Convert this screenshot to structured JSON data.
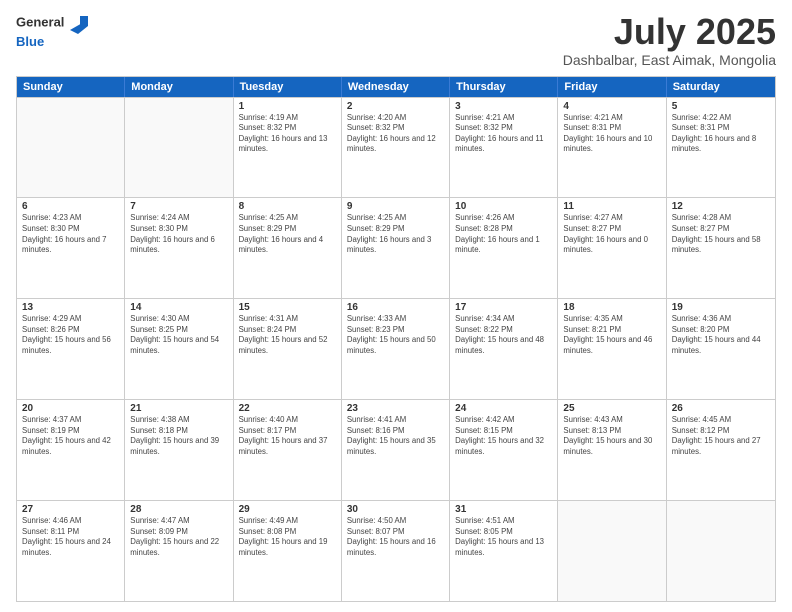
{
  "header": {
    "logo_line1": "General",
    "logo_line2": "Blue",
    "month_title": "July 2025",
    "subtitle": "Dashbalbar, East Aimak, Mongolia"
  },
  "weekdays": [
    "Sunday",
    "Monday",
    "Tuesday",
    "Wednesday",
    "Thursday",
    "Friday",
    "Saturday"
  ],
  "weeks": [
    [
      {
        "day": "",
        "info": ""
      },
      {
        "day": "",
        "info": ""
      },
      {
        "day": "1",
        "info": "Sunrise: 4:19 AM\nSunset: 8:32 PM\nDaylight: 16 hours and 13 minutes."
      },
      {
        "day": "2",
        "info": "Sunrise: 4:20 AM\nSunset: 8:32 PM\nDaylight: 16 hours and 12 minutes."
      },
      {
        "day": "3",
        "info": "Sunrise: 4:21 AM\nSunset: 8:32 PM\nDaylight: 16 hours and 11 minutes."
      },
      {
        "day": "4",
        "info": "Sunrise: 4:21 AM\nSunset: 8:31 PM\nDaylight: 16 hours and 10 minutes."
      },
      {
        "day": "5",
        "info": "Sunrise: 4:22 AM\nSunset: 8:31 PM\nDaylight: 16 hours and 8 minutes."
      }
    ],
    [
      {
        "day": "6",
        "info": "Sunrise: 4:23 AM\nSunset: 8:30 PM\nDaylight: 16 hours and 7 minutes."
      },
      {
        "day": "7",
        "info": "Sunrise: 4:24 AM\nSunset: 8:30 PM\nDaylight: 16 hours and 6 minutes."
      },
      {
        "day": "8",
        "info": "Sunrise: 4:25 AM\nSunset: 8:29 PM\nDaylight: 16 hours and 4 minutes."
      },
      {
        "day": "9",
        "info": "Sunrise: 4:25 AM\nSunset: 8:29 PM\nDaylight: 16 hours and 3 minutes."
      },
      {
        "day": "10",
        "info": "Sunrise: 4:26 AM\nSunset: 8:28 PM\nDaylight: 16 hours and 1 minute."
      },
      {
        "day": "11",
        "info": "Sunrise: 4:27 AM\nSunset: 8:27 PM\nDaylight: 16 hours and 0 minutes."
      },
      {
        "day": "12",
        "info": "Sunrise: 4:28 AM\nSunset: 8:27 PM\nDaylight: 15 hours and 58 minutes."
      }
    ],
    [
      {
        "day": "13",
        "info": "Sunrise: 4:29 AM\nSunset: 8:26 PM\nDaylight: 15 hours and 56 minutes."
      },
      {
        "day": "14",
        "info": "Sunrise: 4:30 AM\nSunset: 8:25 PM\nDaylight: 15 hours and 54 minutes."
      },
      {
        "day": "15",
        "info": "Sunrise: 4:31 AM\nSunset: 8:24 PM\nDaylight: 15 hours and 52 minutes."
      },
      {
        "day": "16",
        "info": "Sunrise: 4:33 AM\nSunset: 8:23 PM\nDaylight: 15 hours and 50 minutes."
      },
      {
        "day": "17",
        "info": "Sunrise: 4:34 AM\nSunset: 8:22 PM\nDaylight: 15 hours and 48 minutes."
      },
      {
        "day": "18",
        "info": "Sunrise: 4:35 AM\nSunset: 8:21 PM\nDaylight: 15 hours and 46 minutes."
      },
      {
        "day": "19",
        "info": "Sunrise: 4:36 AM\nSunset: 8:20 PM\nDaylight: 15 hours and 44 minutes."
      }
    ],
    [
      {
        "day": "20",
        "info": "Sunrise: 4:37 AM\nSunset: 8:19 PM\nDaylight: 15 hours and 42 minutes."
      },
      {
        "day": "21",
        "info": "Sunrise: 4:38 AM\nSunset: 8:18 PM\nDaylight: 15 hours and 39 minutes."
      },
      {
        "day": "22",
        "info": "Sunrise: 4:40 AM\nSunset: 8:17 PM\nDaylight: 15 hours and 37 minutes."
      },
      {
        "day": "23",
        "info": "Sunrise: 4:41 AM\nSunset: 8:16 PM\nDaylight: 15 hours and 35 minutes."
      },
      {
        "day": "24",
        "info": "Sunrise: 4:42 AM\nSunset: 8:15 PM\nDaylight: 15 hours and 32 minutes."
      },
      {
        "day": "25",
        "info": "Sunrise: 4:43 AM\nSunset: 8:13 PM\nDaylight: 15 hours and 30 minutes."
      },
      {
        "day": "26",
        "info": "Sunrise: 4:45 AM\nSunset: 8:12 PM\nDaylight: 15 hours and 27 minutes."
      }
    ],
    [
      {
        "day": "27",
        "info": "Sunrise: 4:46 AM\nSunset: 8:11 PM\nDaylight: 15 hours and 24 minutes."
      },
      {
        "day": "28",
        "info": "Sunrise: 4:47 AM\nSunset: 8:09 PM\nDaylight: 15 hours and 22 minutes."
      },
      {
        "day": "29",
        "info": "Sunrise: 4:49 AM\nSunset: 8:08 PM\nDaylight: 15 hours and 19 minutes."
      },
      {
        "day": "30",
        "info": "Sunrise: 4:50 AM\nSunset: 8:07 PM\nDaylight: 15 hours and 16 minutes."
      },
      {
        "day": "31",
        "info": "Sunrise: 4:51 AM\nSunset: 8:05 PM\nDaylight: 15 hours and 13 minutes."
      },
      {
        "day": "",
        "info": ""
      },
      {
        "day": "",
        "info": ""
      }
    ]
  ]
}
